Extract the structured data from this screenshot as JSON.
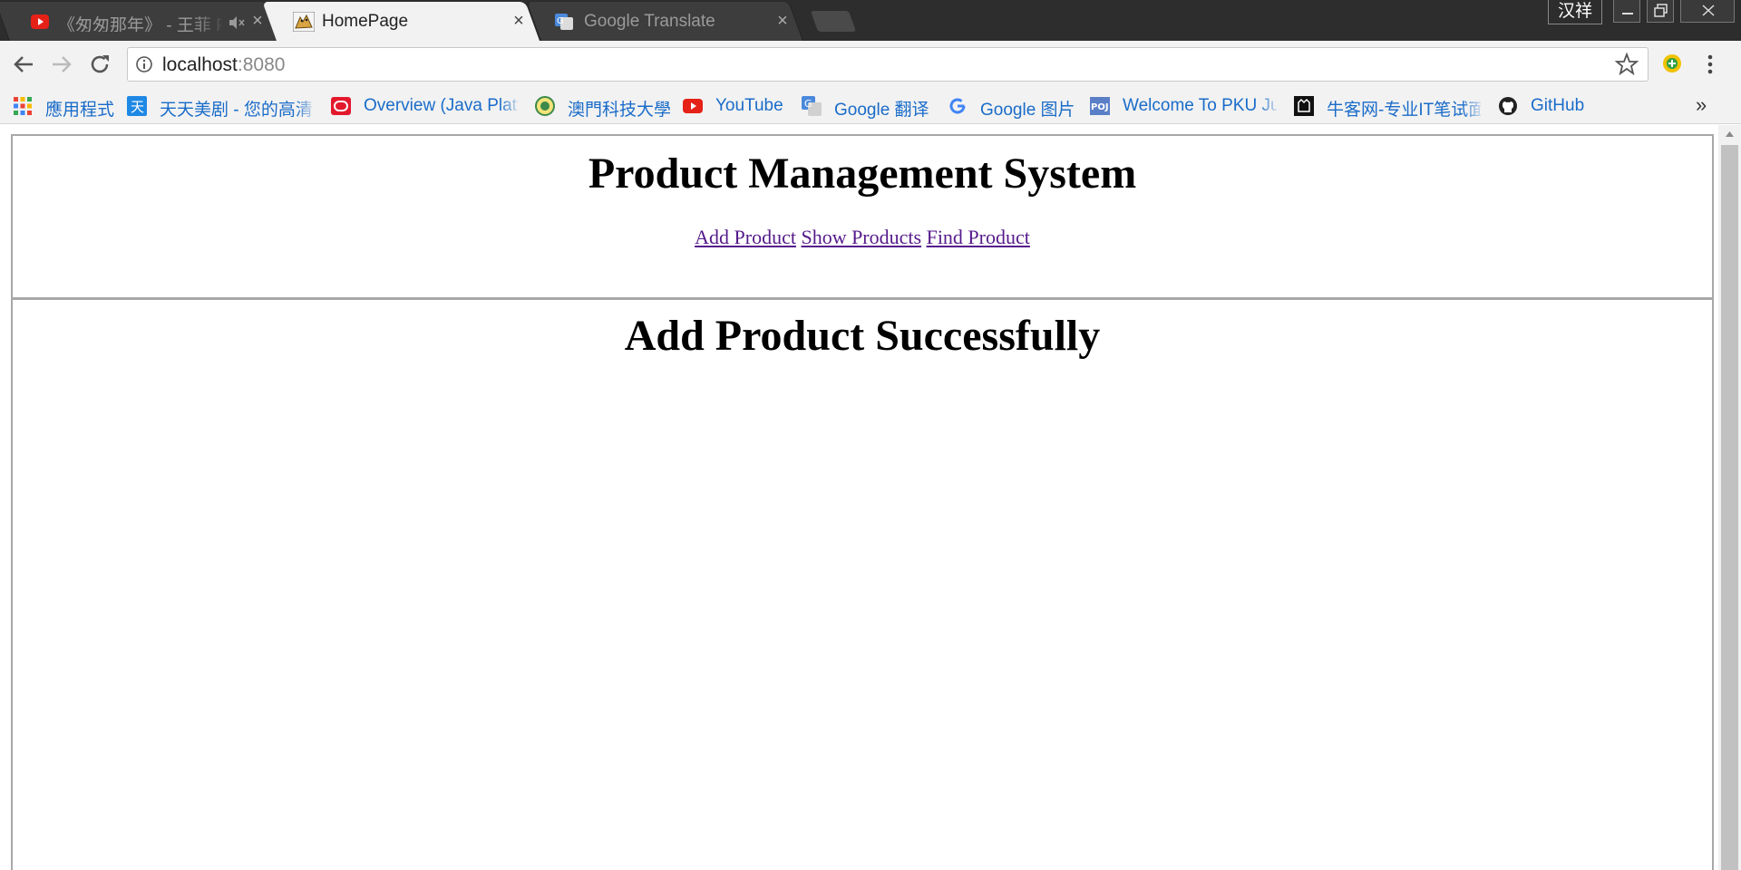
{
  "browser": {
    "tabs": [
      {
        "title": "《匆匆那年》 - 王菲 P",
        "favicon": "youtube-icon",
        "audio": "muted-speaker-icon",
        "active": false
      },
      {
        "title": "HomePage",
        "favicon": "tomcat-icon",
        "active": true
      },
      {
        "title": "Google Translate",
        "favicon": "google-translate-icon",
        "active": false
      }
    ],
    "ime_label": "汉祥",
    "window_controls": {
      "minimize": "minimize-icon",
      "restore": "restore-icon",
      "close": "close-icon"
    },
    "address": {
      "host": "localhost",
      "port": ":8080"
    },
    "bookmarks": [
      {
        "label": "應用程式",
        "icon": "apps-grid-icon"
      },
      {
        "label": "天天美剧 - 您的高清",
        "icon": "tiantian-icon"
      },
      {
        "label": "Overview (Java Platf",
        "icon": "oracle-icon"
      },
      {
        "label": "澳門科技大學",
        "icon": "must-logo-icon"
      },
      {
        "label": "YouTube",
        "icon": "youtube-icon"
      },
      {
        "label": "Google 翻译",
        "icon": "google-translate-icon"
      },
      {
        "label": "Google 图片",
        "icon": "google-g-icon"
      },
      {
        "label": "Welcome To PKU Ju",
        "icon": "poj-icon"
      },
      {
        "label": "牛客网-专业IT笔试面",
        "icon": "nowcoder-icon"
      },
      {
        "label": "GitHub",
        "icon": "github-icon"
      }
    ],
    "bookmarks_overflow": "»"
  },
  "page": {
    "title": "Product Management System",
    "links": [
      "Add Product",
      "Show Products",
      "Find Product"
    ],
    "result": "Add Product Successfully"
  }
}
